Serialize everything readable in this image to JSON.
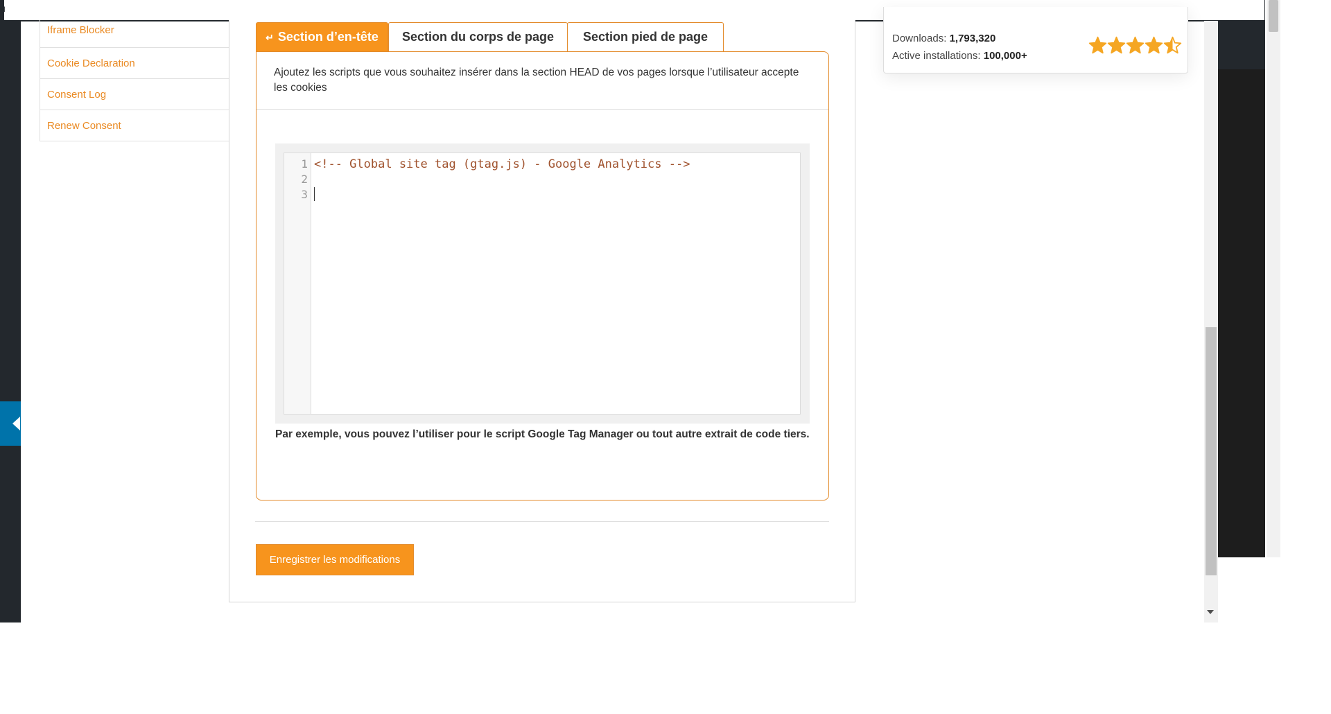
{
  "topbar": {
    "corner_glyph": "u"
  },
  "nav": {
    "items": [
      {
        "label": "Iframe Blocker"
      },
      {
        "label": "Cookie Declaration"
      },
      {
        "label": "Consent Log"
      },
      {
        "label": "Renew Consent"
      }
    ]
  },
  "tabs": {
    "header": {
      "label": "Section d’en-tête",
      "icon": "return-arrow-icon",
      "active": true
    },
    "body": {
      "label": "Section du corps de page"
    },
    "footer": {
      "label": "Section pied de page"
    }
  },
  "card": {
    "description": "Ajoutez les scripts que vous souhaitez insérer dans la section HEAD de vos pages lorsque l’utilisateur accepte les cookies",
    "hint": "Par exemple, vous pouvez l’utiliser pour le script Google Tag Manager ou tout autre extrait de code tiers."
  },
  "editor": {
    "line_numbers": [
      "1",
      "2",
      "3"
    ],
    "lines": [
      "<!-- Global site tag (gtag.js) - Google Analytics -->",
      "",
      ""
    ]
  },
  "actions": {
    "save_label": "Enregistrer les modifications"
  },
  "plugin_info": {
    "downloads_label": "Downloads:",
    "downloads_value": "1,793,320",
    "installs_label": "Active installations:",
    "installs_value": "100,000+",
    "rating": 4.5,
    "rating_max": 5,
    "star_color": "#f5a623"
  },
  "colors": {
    "accent": "#f7941d",
    "accent_border": "#e38b2b",
    "link": "#ea8a23",
    "wp_blue": "#0073aa"
  }
}
